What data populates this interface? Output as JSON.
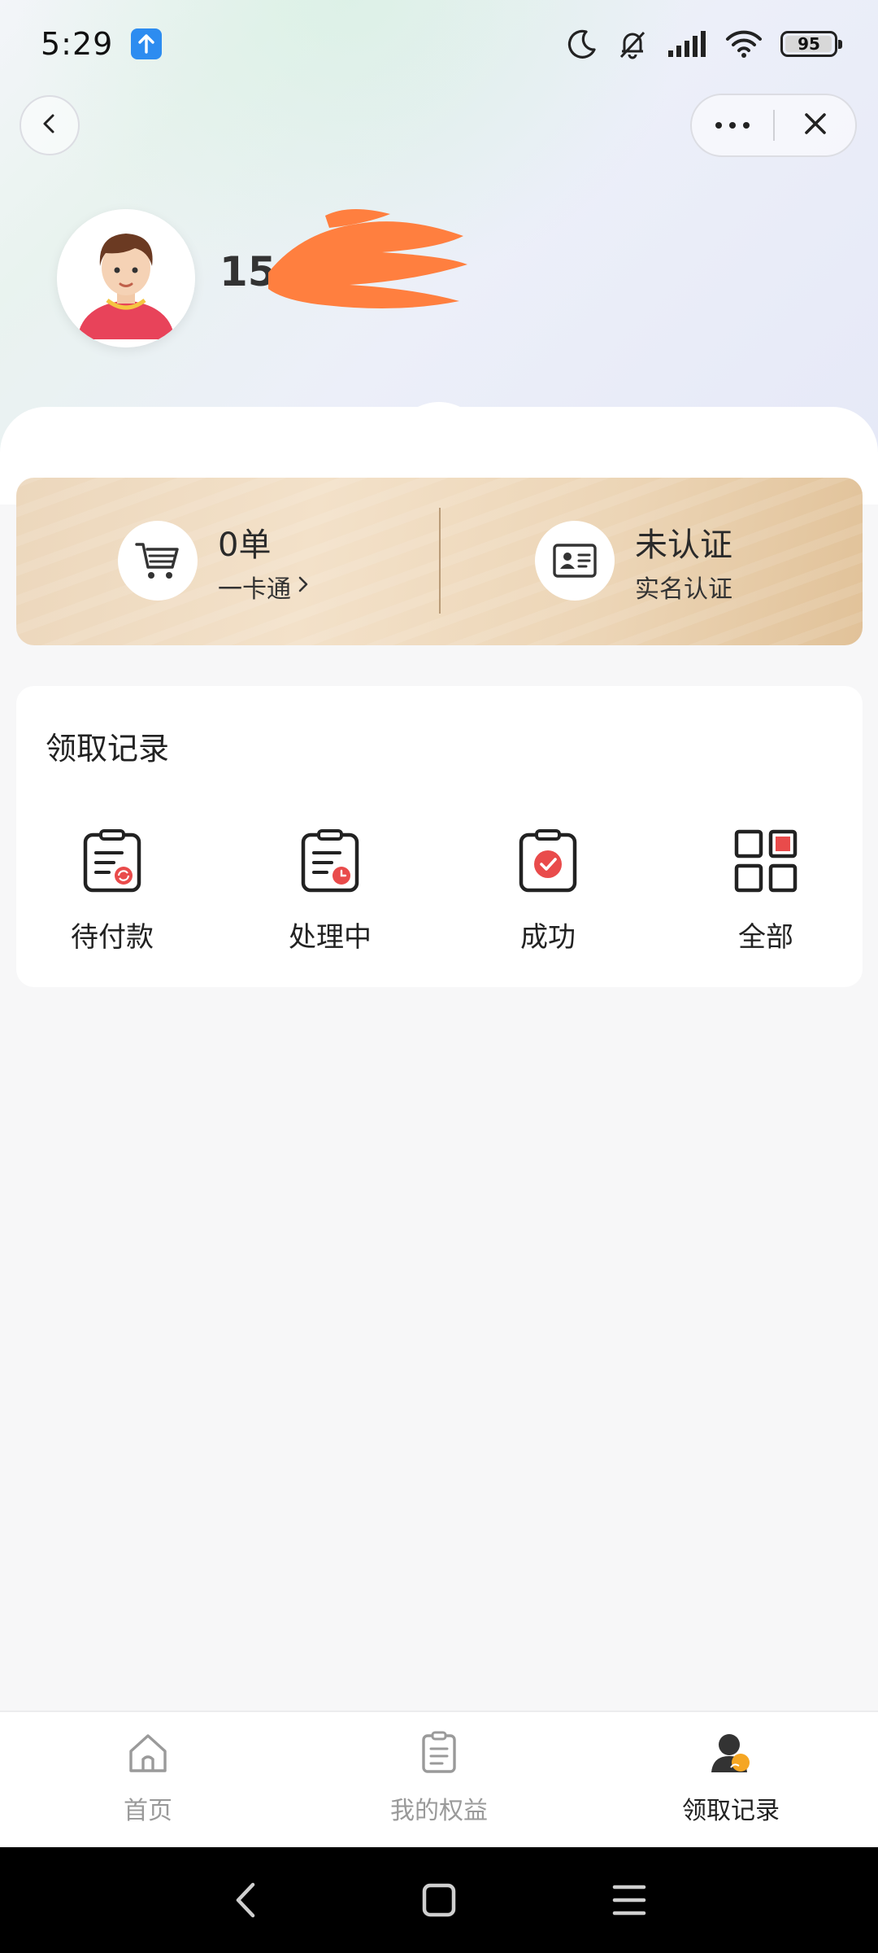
{
  "status_bar": {
    "time": "5:29",
    "battery": "95",
    "icons": [
      "upload-notification-icon",
      "moon-icon",
      "bell-off-icon",
      "signal-icon",
      "wifi-icon",
      "battery-icon"
    ]
  },
  "nav": {
    "icons": [
      "back-icon",
      "more-icon",
      "close-icon"
    ]
  },
  "profile": {
    "name_visible": "15"
  },
  "card": {
    "orders_value": "0单",
    "orders_label": "一卡通",
    "auth_status": "未认证",
    "auth_label": "实名认证"
  },
  "records": {
    "title": "领取记录",
    "items": [
      {
        "label": "待付款",
        "icon": "pending-payment-icon"
      },
      {
        "label": "处理中",
        "icon": "processing-icon"
      },
      {
        "label": "成功",
        "icon": "success-icon"
      },
      {
        "label": "全部",
        "icon": "all-grid-icon"
      }
    ]
  },
  "tabbar": {
    "items": [
      {
        "label": "首页",
        "icon": "home-icon",
        "active": false
      },
      {
        "label": "我的权益",
        "icon": "benefits-icon",
        "active": false
      },
      {
        "label": "领取记录",
        "icon": "user-records-icon",
        "active": true
      }
    ]
  },
  "colors": {
    "accent_red": "#e94b4b",
    "gold_card": "#ecd7bc",
    "redaction": "#ff7f3f"
  }
}
